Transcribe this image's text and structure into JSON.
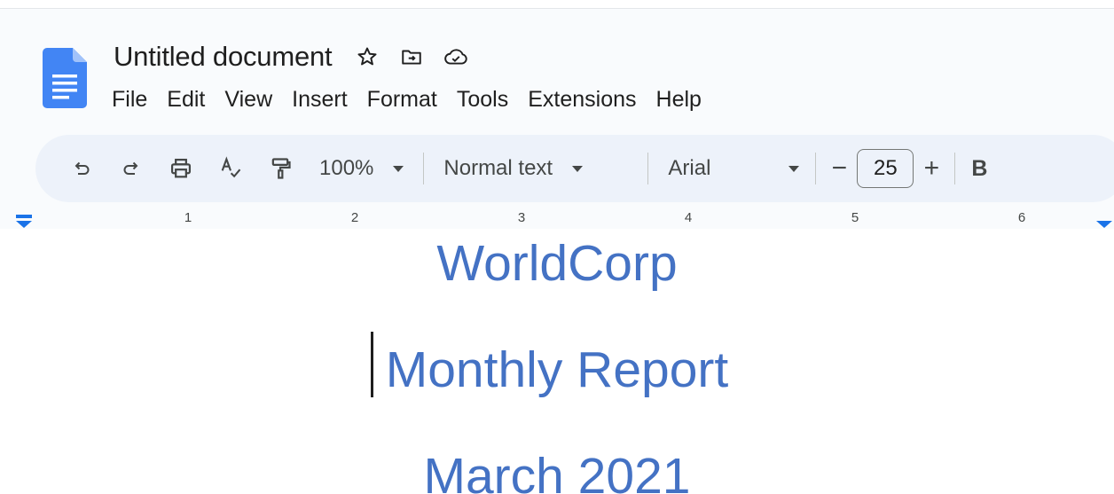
{
  "app": {
    "doc_title": "Untitled document",
    "title_icons": [
      "star-icon",
      "move-to-folder-icon",
      "cloud-saved-icon"
    ]
  },
  "menu": {
    "items": [
      "File",
      "Edit",
      "View",
      "Insert",
      "Format",
      "Tools",
      "Extensions",
      "Help"
    ]
  },
  "toolbar": {
    "zoom": "100%",
    "paragraph_style": "Normal text",
    "font_family": "Arial",
    "font_size": "25",
    "decrease_symbol": "−",
    "increase_symbol": "+",
    "bold_label": "B"
  },
  "ruler": {
    "numbers": [
      "1",
      "2",
      "3",
      "4",
      "5",
      "6"
    ],
    "marker_color": "#1a73e8"
  },
  "document": {
    "lines": [
      "WorldCorp",
      "Monthly Report",
      "March 2021"
    ],
    "text_color": "#4472c4"
  },
  "colors": {
    "header_bg": "#f9fbfd",
    "toolbar_bg": "#edf2fa",
    "docs_blue": "#4285f4"
  }
}
